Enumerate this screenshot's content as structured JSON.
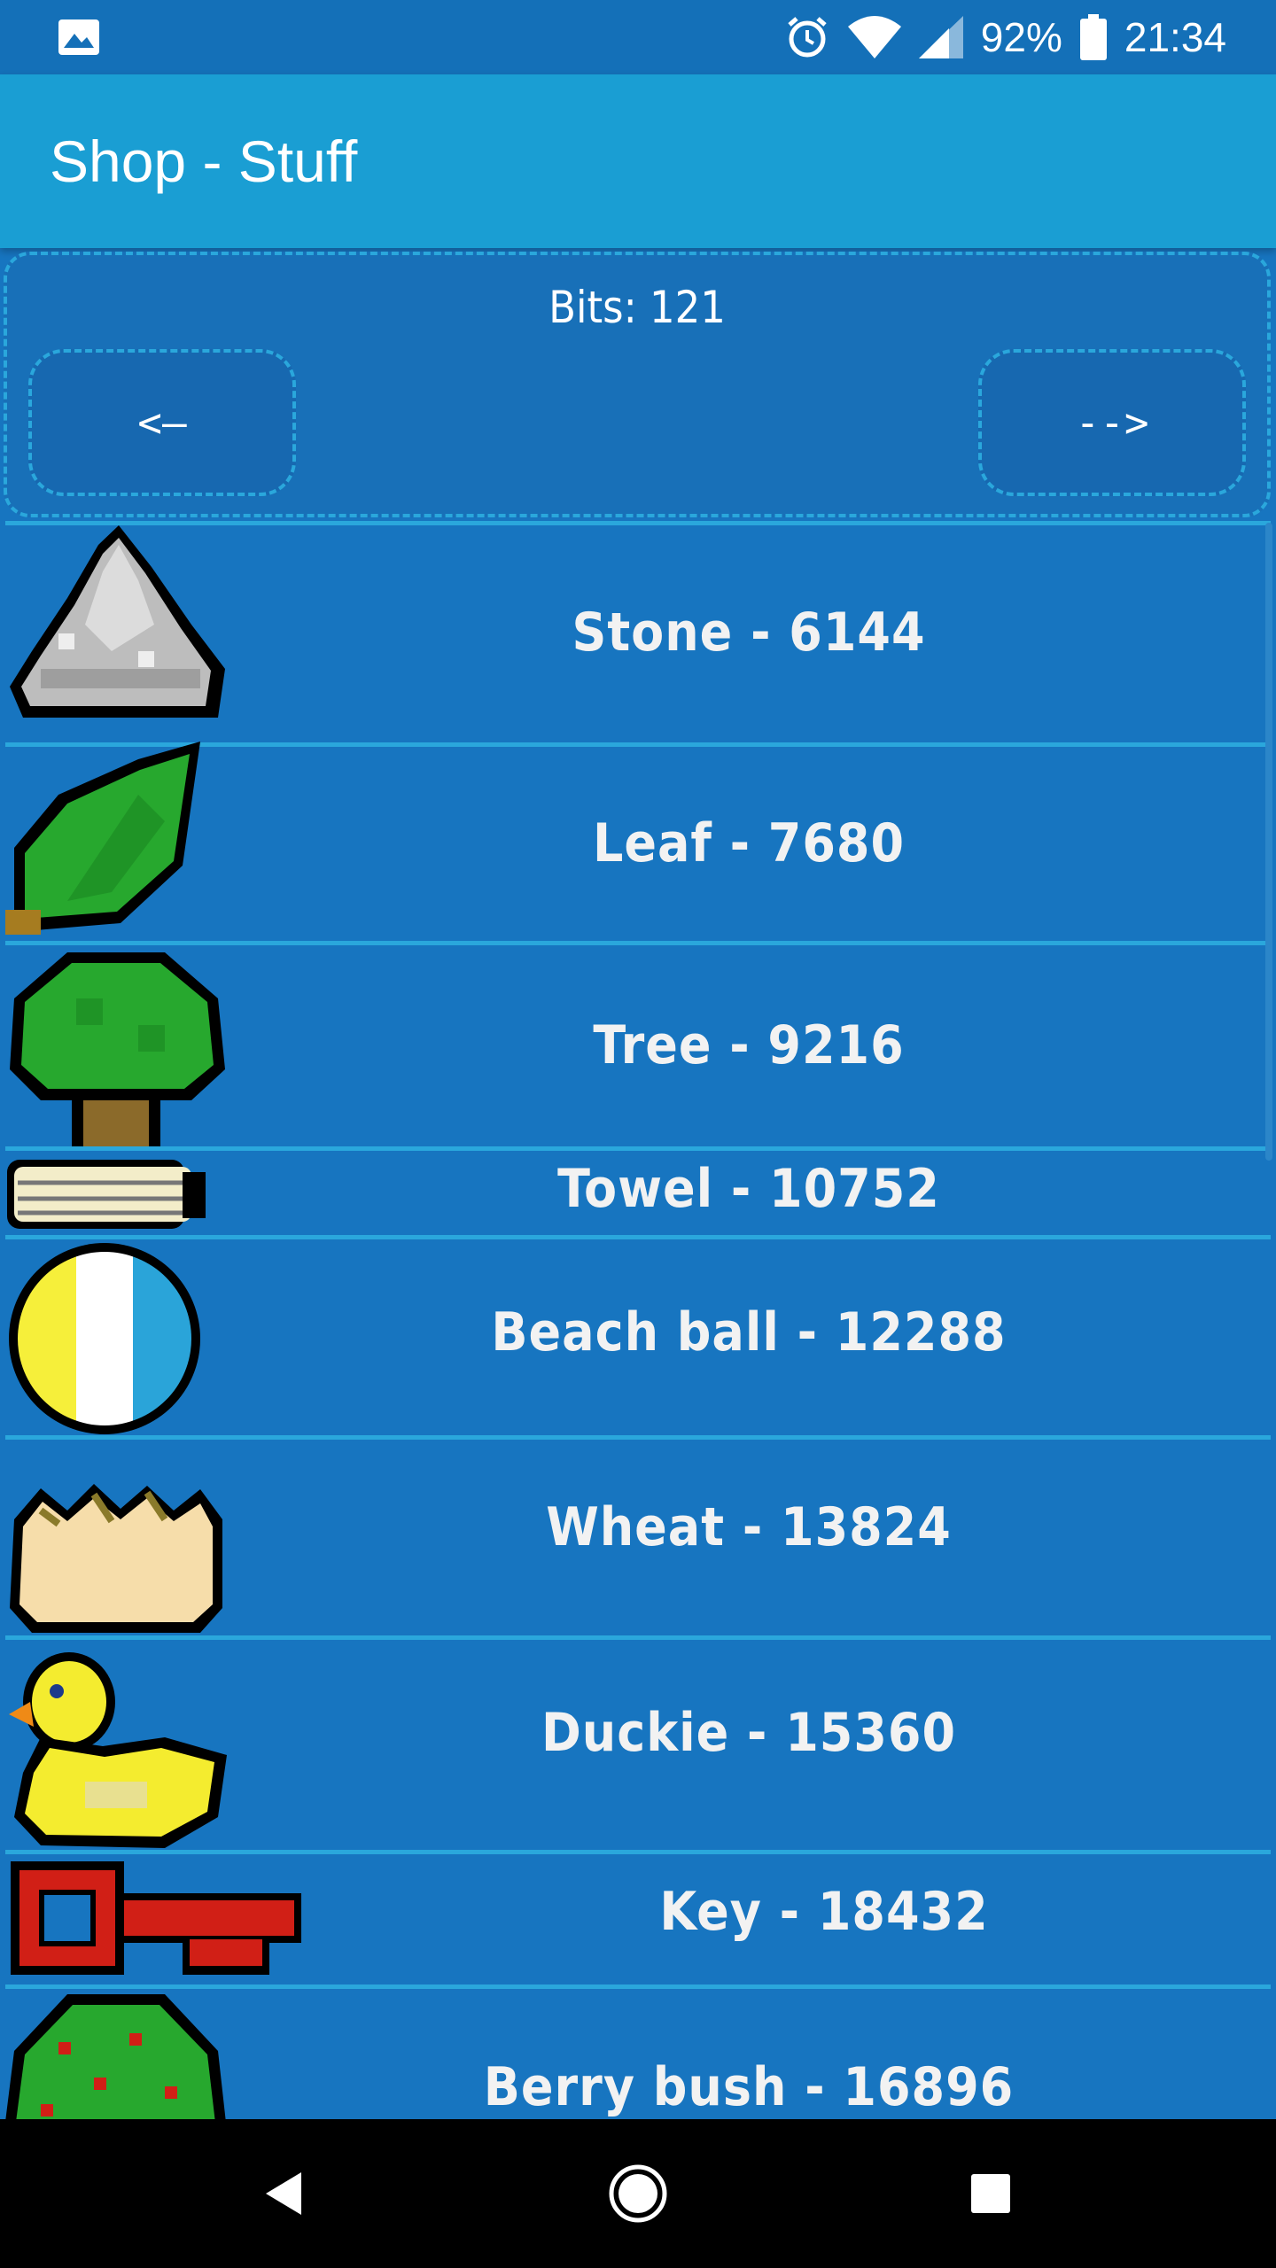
{
  "status_bar": {
    "battery": "92%",
    "time": "21:34",
    "icons": [
      "gallery-icon",
      "alarm-icon",
      "wifi-icon",
      "signal-icon",
      "battery-icon"
    ]
  },
  "app_bar": {
    "title": "Shop - Stuff"
  },
  "header": {
    "bits_label": "Bits: 121",
    "prev_label": "<—",
    "next_label": "-->"
  },
  "items": [
    {
      "label": "Stone - 6144",
      "icon": "stone-icon"
    },
    {
      "label": "Leaf - 7680",
      "icon": "leaf-icon"
    },
    {
      "label": "Tree - 9216",
      "icon": "tree-icon"
    },
    {
      "label": "Towel - 10752",
      "icon": "towel-icon"
    },
    {
      "label": "Beach ball - 12288",
      "icon": "beach-ball-icon"
    },
    {
      "label": "Wheat - 13824",
      "icon": "wheat-icon"
    },
    {
      "label": "Duckie - 15360",
      "icon": "duckie-icon"
    },
    {
      "label": "Key - 18432",
      "icon": "key-icon"
    },
    {
      "label": "Berry bush - 16896",
      "icon": "berry-bush-icon"
    }
  ],
  "colors": {
    "primary": "#1775c0",
    "app_bar": "#1a9ed3",
    "divider": "#2aa7dc"
  }
}
